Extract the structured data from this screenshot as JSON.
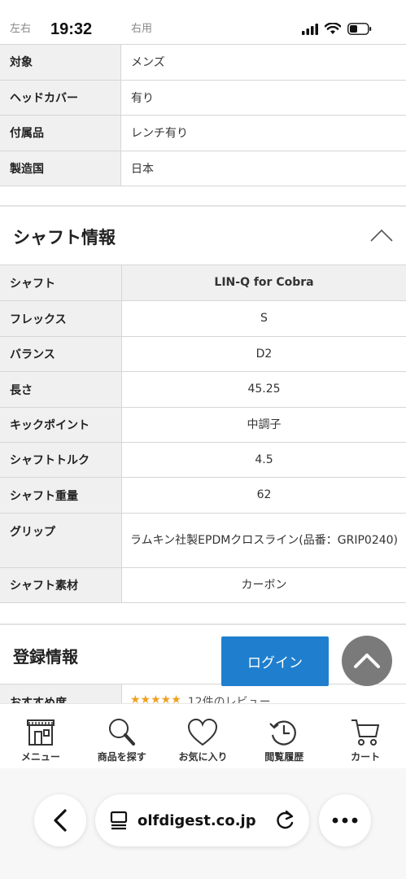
{
  "status_bar": {
    "left_hint": "左右",
    "time": "19:32",
    "mid_hint": "右用"
  },
  "spec_rows": [
    {
      "key": "対象",
      "value": "メンズ"
    },
    {
      "key": "ヘッドカバー",
      "value": "有り"
    },
    {
      "key": "付属品",
      "value": "レンチ有り"
    },
    {
      "key": "製造国",
      "value": "日本"
    }
  ],
  "shaft_section": {
    "title": "シャフト情報",
    "rows": [
      {
        "key": "シャフト",
        "value": "LIN-Q for Cobra"
      },
      {
        "key": "フレックス",
        "value": "S"
      },
      {
        "key": "バランス",
        "value": "D2"
      },
      {
        "key": "長さ",
        "value": "45.25"
      },
      {
        "key": "キックポイント",
        "value": "中調子"
      },
      {
        "key": "シャフトトルク",
        "value": "4.5"
      },
      {
        "key": "シャフト重量",
        "value": "62"
      },
      {
        "key": "グリップ",
        "value": "ラムキン社製EPDMクロスライン(品番：GRIP0240)"
      },
      {
        "key": "シャフト素材",
        "value": "カーボン"
      }
    ]
  },
  "registration_section": {
    "title": "登録情報",
    "recommend_key": "おすすめ度",
    "stars": "★★★★★",
    "review_text": "12件のレビュー"
  },
  "login_button": "ログイン",
  "bottom_nav": [
    {
      "label": "メニュー",
      "icon": "store-icon"
    },
    {
      "label": "商品を探す",
      "icon": "search-icon"
    },
    {
      "label": "お気に入り",
      "icon": "heart-icon"
    },
    {
      "label": "閲覧履歴",
      "icon": "history-icon"
    },
    {
      "label": "カート",
      "icon": "cart-icon"
    }
  ],
  "browser": {
    "url": "olfdigest.co.jp"
  }
}
